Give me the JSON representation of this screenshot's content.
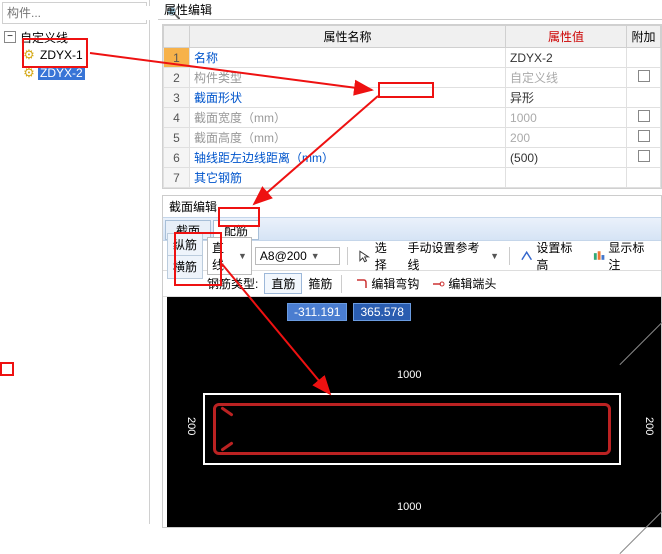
{
  "search": {
    "placeholder": "构件..."
  },
  "tree": {
    "root": "自定义线",
    "items": [
      "ZDYX-1",
      "ZDYX-2"
    ],
    "selected": "ZDYX-2"
  },
  "propPanel": {
    "title": "属性编辑",
    "headers": {
      "name": "属性名称",
      "value": "属性值",
      "extra": "附加"
    },
    "rows": [
      {
        "n": "1",
        "name": "名称",
        "val": "ZDYX-2",
        "nameCls": "name",
        "valCls": "val",
        "chk": false,
        "sel": true
      },
      {
        "n": "2",
        "name": "构件类型",
        "val": "自定义线",
        "nameCls": "name dis",
        "valCls": "val dis",
        "chk": true
      },
      {
        "n": "3",
        "name": "截面形状",
        "val": "异形",
        "nameCls": "name",
        "valCls": "val",
        "chk": false
      },
      {
        "n": "4",
        "name": "截面宽度（mm）",
        "val": "1000",
        "nameCls": "name dis",
        "valCls": "val dis",
        "chk": true
      },
      {
        "n": "5",
        "name": "截面高度（mm）",
        "val": "200",
        "nameCls": "name dis",
        "valCls": "val dis",
        "chk": true
      },
      {
        "n": "6",
        "name": "轴线距左边线距离（mm）",
        "val": "(500)",
        "nameCls": "name",
        "valCls": "val",
        "chk": true
      },
      {
        "n": "7",
        "name": "其它钢筋",
        "val": "",
        "nameCls": "name",
        "valCls": "val",
        "chk": false
      }
    ]
  },
  "section": {
    "title": "截面编辑",
    "tabs": [
      "截面",
      "配筋"
    ],
    "sideTabs": [
      "纵筋",
      "横筋"
    ],
    "toolbar": {
      "lineType": "直线",
      "rebarSpec": "A8@200",
      "select": "选择",
      "manualRef": "手动设置参考线",
      "setElev": "设置标高",
      "showMark": "显示标注"
    },
    "toolbar2": {
      "rebarTypeLabel": "钢筋类型:",
      "straight": "直筋",
      "stirrup": "箍筋",
      "editHook": "编辑弯钩",
      "editEnd": "编辑端头"
    },
    "canvas": {
      "x": "-311.191",
      "y": "365.578",
      "dimW": "1000",
      "dimH": "200"
    }
  }
}
